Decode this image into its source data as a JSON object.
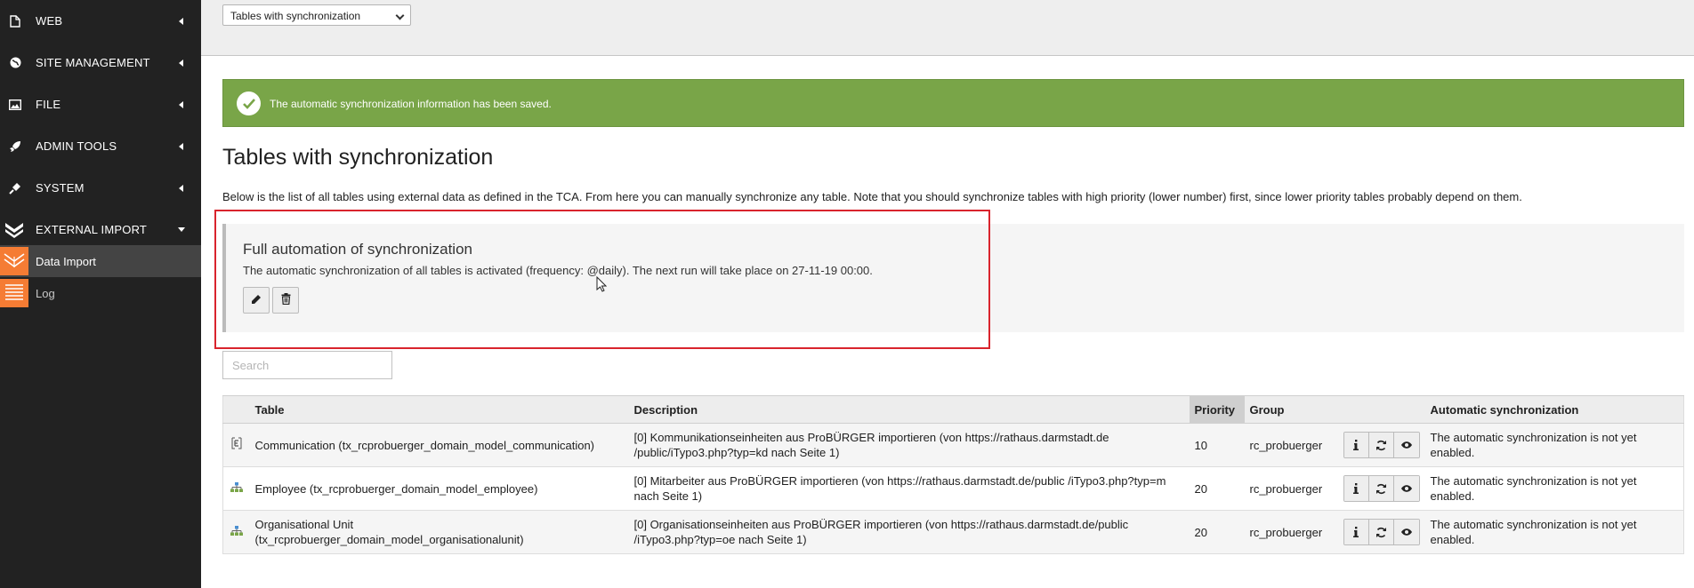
{
  "sidebar": {
    "groups": [
      {
        "label": "WEB",
        "icon": "page-icon"
      },
      {
        "label": "SITE MANAGEMENT",
        "icon": "globe-icon"
      },
      {
        "label": "FILE",
        "icon": "image-icon"
      },
      {
        "label": "ADMIN TOOLS",
        "icon": "rocket-icon"
      },
      {
        "label": "SYSTEM",
        "icon": "plug-icon"
      },
      {
        "label": "EXTERNAL IMPORT",
        "icon": "import-icon"
      }
    ],
    "items": [
      {
        "label": "Data Import",
        "icon": "data-import-icon"
      },
      {
        "label": "Log",
        "icon": "log-icon"
      }
    ]
  },
  "toolbar": {
    "select_value": "Tables with synchronization"
  },
  "flash": {
    "message": "The automatic synchronization information has been saved."
  },
  "page": {
    "title": "Tables with synchronization",
    "intro": "Below is the list of all tables using external data as defined in the TCA. From here you can manually synchronize any table. Note that you should synchronize tables with high priority (lower number) first, since lower priority tables probably depend on them."
  },
  "automation": {
    "title": "Full automation of synchronization",
    "text": "The automatic synchronization of all tables is activated (frequency: @daily). The next run will take place on 27-11-19 00:00."
  },
  "search": {
    "placeholder": "Search"
  },
  "table": {
    "headers": {
      "table": "Table",
      "description": "Description",
      "priority": "Priority",
      "group": "Group",
      "auto": "Automatic synchronization"
    },
    "rows": [
      {
        "icon": "record-icon",
        "table": "Communication (tx_rcprobuerger_domain_model_communication)",
        "description": "[0] Kommunikationseinheiten aus ProBÜRGER importieren (von https://rathaus.darmstadt.de /public/iTypo3.php?typ=kd nach Seite 1)",
        "priority": "10",
        "group": "rc_probuerger",
        "auto": "The automatic synchronization is not yet enabled."
      },
      {
        "icon": "org-icon",
        "table": "Employee (tx_rcprobuerger_domain_model_employee)",
        "description": "[0] Mitarbeiter aus ProBÜRGER importieren (von https://rathaus.darmstadt.de/public /iTypo3.php?typ=m nach Seite 1)",
        "priority": "20",
        "group": "rc_probuerger",
        "auto": "The automatic synchronization is not yet enabled."
      },
      {
        "icon": "org-icon",
        "table": "Organisational Unit (tx_rcprobuerger_domain_model_organisationalunit)",
        "description": "[0] Organisationseinheiten aus ProBÜRGER importieren (von https://rathaus.darmstadt.de/public /iTypo3.php?typ=oe nach Seite 1)",
        "priority": "20",
        "group": "rc_probuerger",
        "auto": "The automatic synchronization is not yet enabled."
      }
    ]
  },
  "colors": {
    "sidebar_bg": "#222222",
    "module_accent": "#f57c34",
    "success": "#79a548",
    "highlight_border": "#d9242d"
  }
}
